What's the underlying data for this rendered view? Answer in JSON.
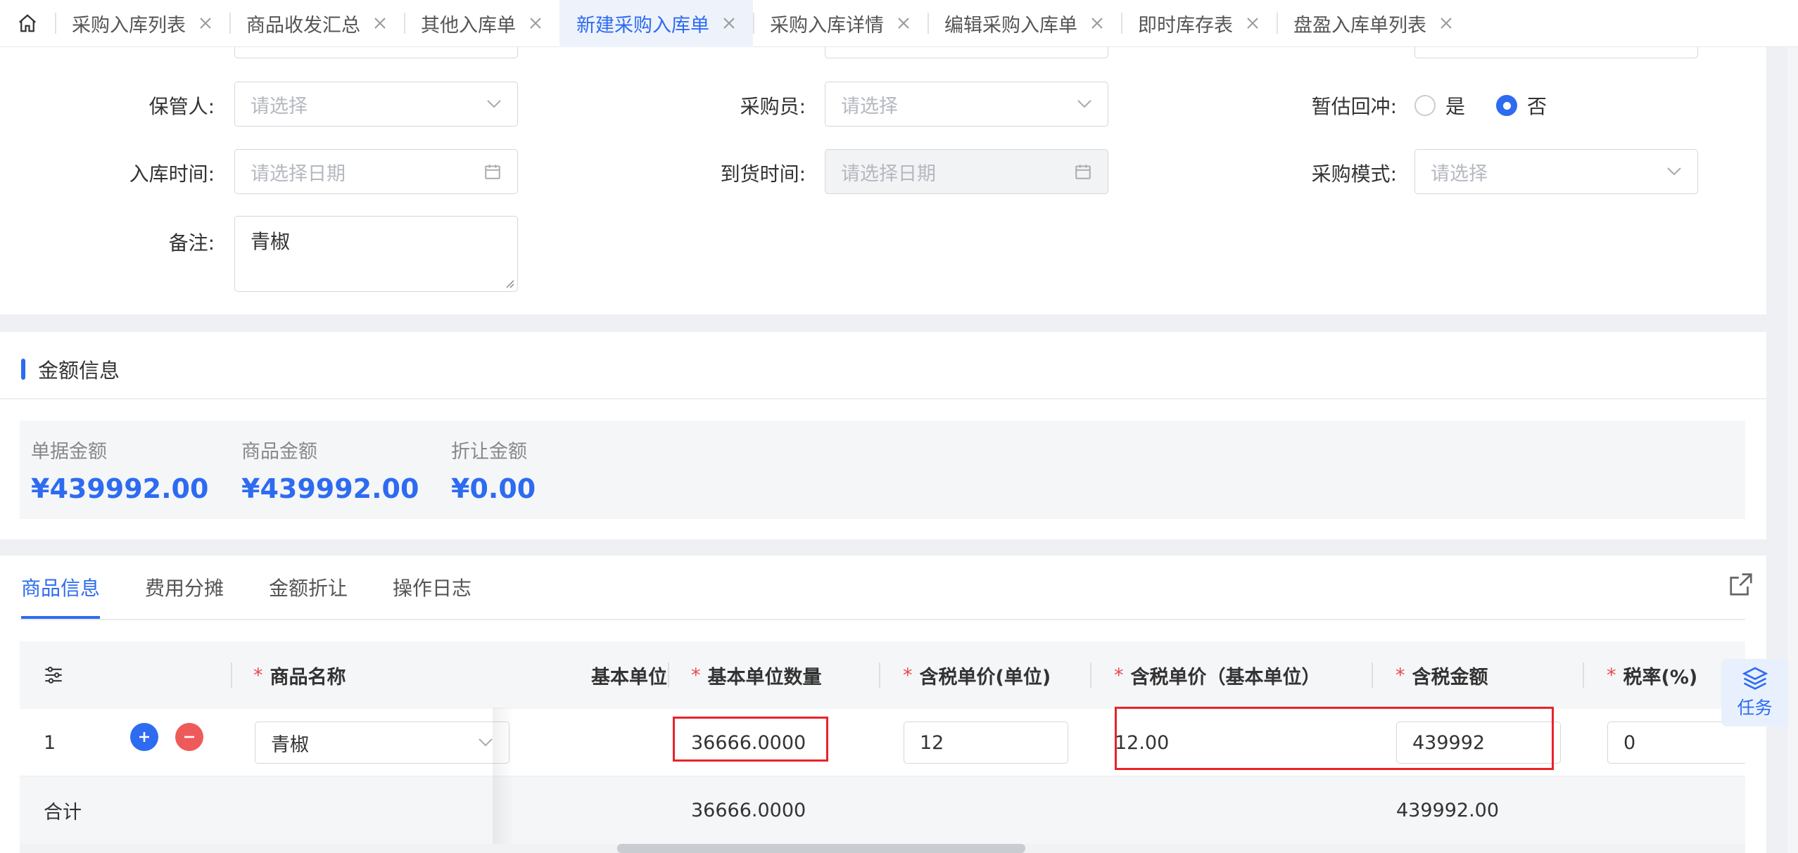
{
  "tabs": [
    {
      "label": "采购入库列表",
      "active": false
    },
    {
      "label": "商品收发汇总",
      "active": false
    },
    {
      "label": "其他入库单",
      "active": false
    },
    {
      "label": "新建采购入库单",
      "active": true
    },
    {
      "label": "采购入库详情",
      "active": false
    },
    {
      "label": "编辑采购入库单",
      "active": false
    },
    {
      "label": "即时库存表",
      "active": false
    },
    {
      "label": "盘盈入库单列表",
      "active": false
    }
  ],
  "form": {
    "keeper": {
      "label": "保管人:",
      "placeholder": "请选择"
    },
    "buyer": {
      "label": "采购员:",
      "placeholder": "请选择"
    },
    "provisional": {
      "label": "暂估回冲:",
      "yes": "是",
      "no": "否",
      "selected": "否"
    },
    "in_time": {
      "label": "入库时间:",
      "placeholder": "请选择日期"
    },
    "arrival_time": {
      "label": "到货时间:",
      "placeholder": "请选择日期"
    },
    "purchase_mode": {
      "label": "采购模式:",
      "placeholder": "请选择"
    },
    "remark": {
      "label": "备注:",
      "value": "青椒"
    }
  },
  "amount": {
    "title": "金额信息",
    "items": [
      {
        "caption": "单据金额",
        "value": "¥439992.00"
      },
      {
        "caption": "商品金额",
        "value": "¥439992.00"
      },
      {
        "caption": "折让金额",
        "value": "¥0.00"
      }
    ]
  },
  "goods_tabs": [
    "商品信息",
    "费用分摊",
    "金额折让",
    "操作日志"
  ],
  "table": {
    "headers": {
      "name": "商品名称",
      "base_unit": "基本单位",
      "base_qty": "基本单位数量",
      "price_unit": "含税单价(单位)",
      "price_base": "含税单价（基本单位）",
      "amount": "含税金额",
      "tax_rate": "税率(%)"
    },
    "row": {
      "index": "1",
      "name": "青椒",
      "base_qty": "36666.0000",
      "price_unit": "12",
      "price_base": "12.00",
      "amount": "439992",
      "tax_rate": "0"
    },
    "summary": {
      "label": "合计",
      "base_qty": "36666.0000",
      "amount": "439992.00"
    }
  },
  "float": {
    "task_label": "任务"
  },
  "colors": {
    "accent": "#2d6bf0",
    "required": "#e84a4a",
    "highlight": "#e8232a"
  }
}
